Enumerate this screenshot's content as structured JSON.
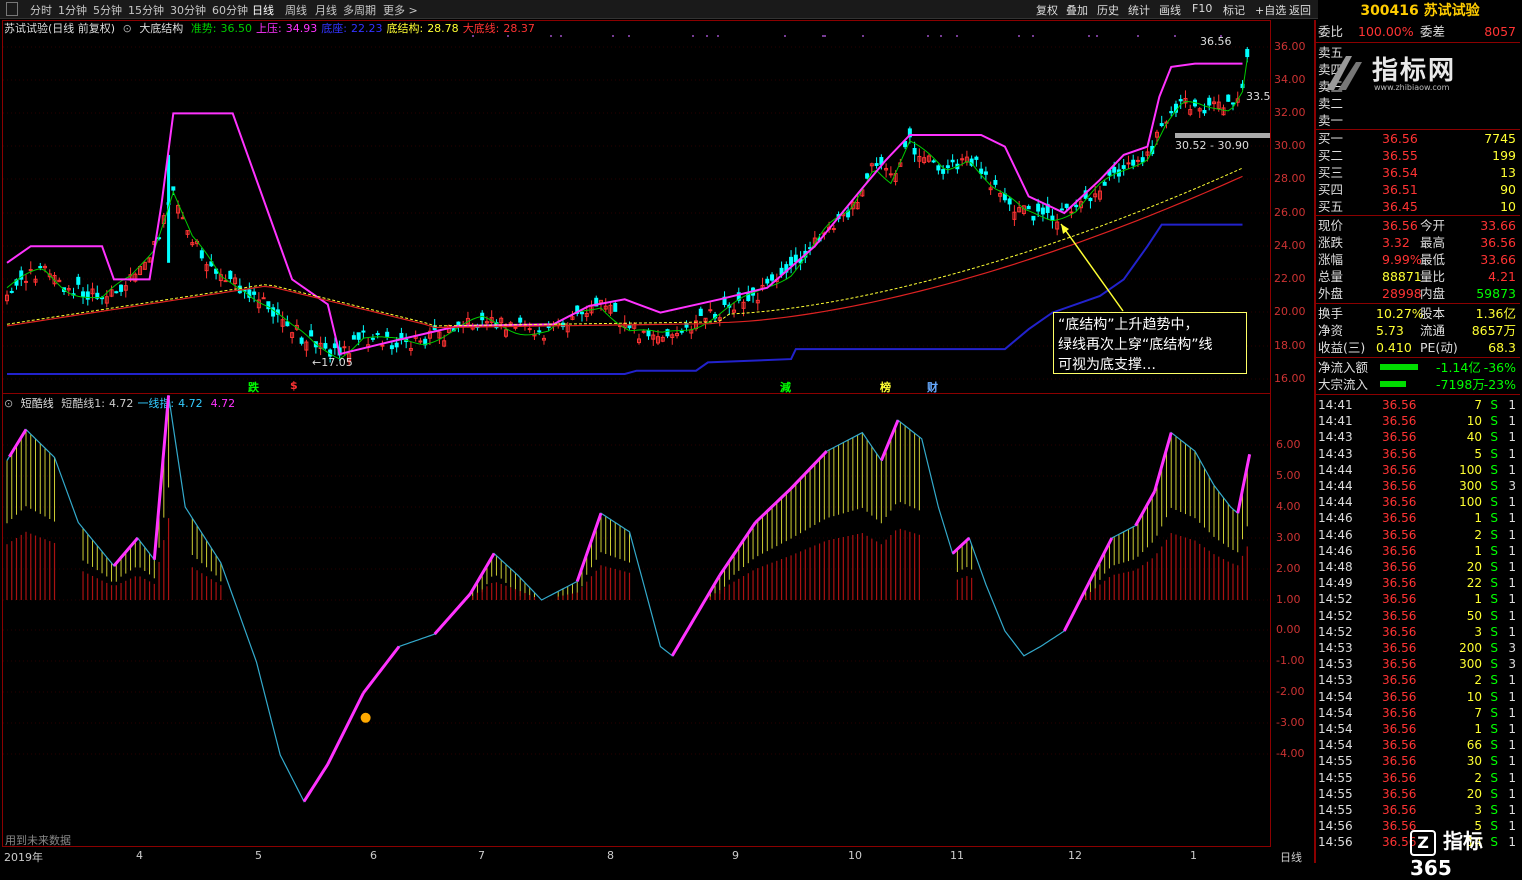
{
  "toolbar": {
    "tabs": [
      {
        "label": "分时",
        "active": false
      },
      {
        "label": "1分钟",
        "active": false
      },
      {
        "label": "5分钟",
        "active": false
      },
      {
        "label": "15分钟",
        "active": false
      },
      {
        "label": "30分钟",
        "active": false
      },
      {
        "label": "60分钟",
        "active": false
      },
      {
        "label": "日线",
        "active": true
      },
      {
        "label": "周线",
        "active": false
      },
      {
        "label": "月线",
        "active": false
      },
      {
        "label": "多周期",
        "active": false
      },
      {
        "label": "更多 >",
        "active": false
      }
    ],
    "right_buttons": [
      "复权",
      "叠加",
      "历史",
      "统计",
      "画线",
      "F10",
      "标记",
      "+自选",
      "返回"
    ]
  },
  "stock": {
    "code": "300416",
    "name": "苏试试验"
  },
  "main_chart": {
    "title": "苏试试验(日线 前复权)",
    "indicator": "大底结构",
    "values": [
      {
        "label": "准势:",
        "value": "36.50",
        "color": "#00cc00"
      },
      {
        "label": "上压:",
        "value": "34.93",
        "color": "#ff33ff"
      },
      {
        "label": "底座:",
        "value": "22.23",
        "color": "#3333ff"
      },
      {
        "label": "底结构:",
        "value": "28.78",
        "color": "#ffff33"
      },
      {
        "label": "大底线:",
        "value": "28.37",
        "color": "#ff3333"
      }
    ],
    "y_axis": [
      "36.00",
      "34.00",
      "32.00",
      "30.00",
      "28.00",
      "26.00",
      "24.00",
      "22.00",
      "20.00",
      "18.00",
      "16.00"
    ],
    "annotations": {
      "high": "36.56",
      "box_label": "33.5",
      "range": "30.52 - 30.90",
      "low": "17.05"
    },
    "signals": [
      {
        "text": "跌",
        "color": "#00ff00"
      },
      {
        "text": "$",
        "color": "#ff3333"
      },
      {
        "text": "減",
        "color": "#00ff00"
      },
      {
        "text": "榜",
        "color": "#ffff33"
      },
      {
        "text": "财",
        "color": "#66aaff"
      }
    ],
    "callout": [
      "“底结构”上升趋势中，",
      "绿线再次上穿“底结构”线",
      "可视为底支撑…"
    ]
  },
  "osc_chart": {
    "title": "短酷线",
    "values": [
      {
        "label": "短酷线1:",
        "value": "4.72",
        "color": "#cccccc"
      },
      {
        "label": "一线指:",
        "value": "4.72",
        "color": "#33ccff"
      },
      {
        "label": "",
        "value": "4.72",
        "color": "#ff33ff"
      }
    ],
    "y_axis": [
      "6.00",
      "5.00",
      "4.00",
      "3.00",
      "2.00",
      "1.00",
      "0.00",
      "-1.00",
      "-2.00",
      "-3.00",
      "-4.00"
    ],
    "footer": "用到未来数据"
  },
  "x_axis": [
    "2019年",
    "4",
    "5",
    "6",
    "7",
    "8",
    "9",
    "10",
    "11",
    "12",
    "1"
  ],
  "x_axis_right": "日线",
  "quote": {
    "weibi": {
      "label": "委比",
      "value": "100.00%",
      "label2": "委差",
      "value2": "8057"
    },
    "sells": [
      {
        "label": "卖五",
        "price": "",
        "vol": ""
      },
      {
        "label": "卖四",
        "price": "",
        "vol": ""
      },
      {
        "label": "卖三",
        "price": "",
        "vol": ""
      },
      {
        "label": "卖二",
        "price": "",
        "vol": ""
      },
      {
        "label": "卖一",
        "price": "",
        "vol": ""
      }
    ],
    "buys": [
      {
        "label": "买一",
        "price": "36.56",
        "vol": "7745"
      },
      {
        "label": "买二",
        "price": "36.55",
        "vol": "199"
      },
      {
        "label": "买三",
        "price": "36.54",
        "vol": "13"
      },
      {
        "label": "买四",
        "price": "36.51",
        "vol": "90"
      },
      {
        "label": "买五",
        "price": "36.45",
        "vol": "10"
      }
    ],
    "stats": [
      {
        "l1": "现价",
        "v1": "36.56",
        "c1": "#ff3333",
        "l2": "今开",
        "v2": "33.66",
        "c2": "#ff3333"
      },
      {
        "l1": "涨跌",
        "v1": "3.32",
        "c1": "#ff3333",
        "l2": "最高",
        "v2": "36.56",
        "c2": "#ff3333"
      },
      {
        "l1": "涨幅",
        "v1": "9.99%",
        "c1": "#ff3333",
        "l2": "最低",
        "v2": "33.66",
        "c2": "#ff3333"
      },
      {
        "l1": "总量",
        "v1": "88871",
        "c1": "#ffff33",
        "l2": "量比",
        "v2": "4.21",
        "c2": "#ff3333"
      },
      {
        "l1": "外盘",
        "v1": "28998",
        "c1": "#ff3333",
        "l2": "内盘",
        "v2": "59873",
        "c2": "#00ff00"
      }
    ],
    "stats2": [
      {
        "l1": "换手",
        "v1": "10.27%",
        "c1": "#ffff33",
        "l2": "股本",
        "v2": "1.36亿",
        "c2": "#ffff33"
      },
      {
        "l1": "净资",
        "v1": "5.73",
        "c1": "#ffff33",
        "l2": "流通",
        "v2": "8657万",
        "c2": "#ffff33"
      },
      {
        "l1": "收益(三)",
        "v1": "0.410",
        "c1": "#ffff33",
        "l2": "PE(动)",
        "v2": "68.3",
        "c2": "#ffff33"
      }
    ],
    "flows": [
      {
        "label": "净流入额",
        "value": "-1.14亿",
        "pct": "-36%"
      },
      {
        "label": "大宗流入",
        "value": "-7198万",
        "pct": "-23%"
      }
    ]
  },
  "ticks": [
    {
      "t": "14:41",
      "p": "36.56",
      "v": "7",
      "s": "S",
      "n": "1"
    },
    {
      "t": "14:41",
      "p": "36.56",
      "v": "10",
      "s": "S",
      "n": "1"
    },
    {
      "t": "14:43",
      "p": "36.56",
      "v": "40",
      "s": "S",
      "n": "1"
    },
    {
      "t": "14:43",
      "p": "36.56",
      "v": "5",
      "s": "S",
      "n": "1"
    },
    {
      "t": "14:44",
      "p": "36.56",
      "v": "100",
      "s": "S",
      "n": "1"
    },
    {
      "t": "14:44",
      "p": "36.56",
      "v": "300",
      "s": "S",
      "n": "3"
    },
    {
      "t": "14:44",
      "p": "36.56",
      "v": "100",
      "s": "S",
      "n": "1"
    },
    {
      "t": "14:46",
      "p": "36.56",
      "v": "1",
      "s": "S",
      "n": "1"
    },
    {
      "t": "14:46",
      "p": "36.56",
      "v": "2",
      "s": "S",
      "n": "1"
    },
    {
      "t": "14:46",
      "p": "36.56",
      "v": "1",
      "s": "S",
      "n": "1"
    },
    {
      "t": "14:48",
      "p": "36.56",
      "v": "20",
      "s": "S",
      "n": "1"
    },
    {
      "t": "14:49",
      "p": "36.56",
      "v": "22",
      "s": "S",
      "n": "1"
    },
    {
      "t": "14:52",
      "p": "36.56",
      "v": "1",
      "s": "S",
      "n": "1"
    },
    {
      "t": "14:52",
      "p": "36.56",
      "v": "50",
      "s": "S",
      "n": "1"
    },
    {
      "t": "14:52",
      "p": "36.56",
      "v": "3",
      "s": "S",
      "n": "1"
    },
    {
      "t": "14:53",
      "p": "36.56",
      "v": "200",
      "s": "S",
      "n": "3"
    },
    {
      "t": "14:53",
      "p": "36.56",
      "v": "300",
      "s": "S",
      "n": "3"
    },
    {
      "t": "14:53",
      "p": "36.56",
      "v": "2",
      "s": "S",
      "n": "1"
    },
    {
      "t": "14:54",
      "p": "36.56",
      "v": "10",
      "s": "S",
      "n": "1"
    },
    {
      "t": "14:54",
      "p": "36.56",
      "v": "7",
      "s": "S",
      "n": "1"
    },
    {
      "t": "14:54",
      "p": "36.56",
      "v": "1",
      "s": "S",
      "n": "1"
    },
    {
      "t": "14:54",
      "p": "36.56",
      "v": "66",
      "s": "S",
      "n": "1"
    },
    {
      "t": "14:55",
      "p": "36.56",
      "v": "30",
      "s": "S",
      "n": "1"
    },
    {
      "t": "14:55",
      "p": "36.56",
      "v": "2",
      "s": "S",
      "n": "1"
    },
    {
      "t": "14:55",
      "p": "36.56",
      "v": "20",
      "s": "S",
      "n": "1"
    },
    {
      "t": "14:55",
      "p": "36.56",
      "v": "3",
      "s": "S",
      "n": "1"
    },
    {
      "t": "14:56",
      "p": "36.56",
      "v": "5",
      "s": "S",
      "n": "1"
    },
    {
      "t": "14:56",
      "p": "36.56",
      "v": "14",
      "s": "S",
      "n": "1"
    }
  ],
  "watermark": {
    "text": "指标网",
    "url": "www.zhibiaow.com"
  },
  "brand": "指标365",
  "colors": {
    "up": "#ff3333",
    "down": "#00ffff",
    "border": "#8b0000",
    "magenta": "#ff33ff",
    "green": "#00cc00",
    "blue": "#2222cc",
    "yellow": "#ffff33"
  }
}
